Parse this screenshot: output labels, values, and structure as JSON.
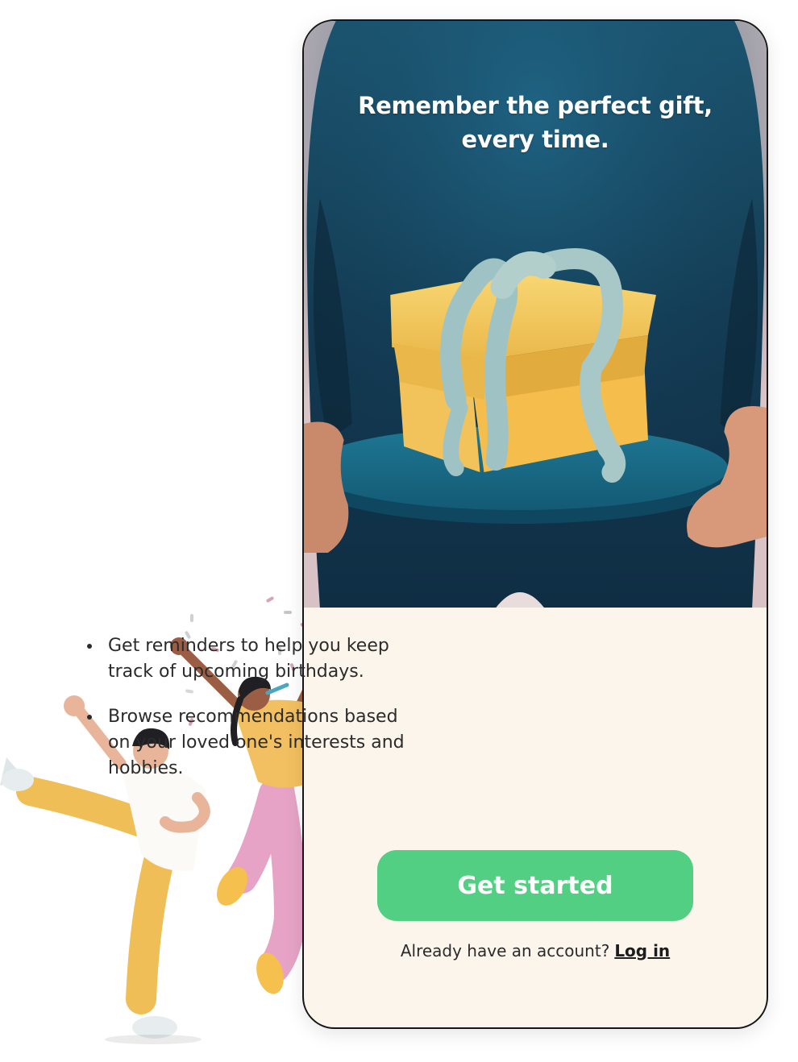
{
  "hero": {
    "title_line1": "Remember the perfect gift,",
    "title_line2": "every time.",
    "illustration": "person-holding-wrapped-gift-on-tray"
  },
  "features": {
    "items": [
      {
        "text": "Get reminders to help you keep track of upcoming birthdays."
      },
      {
        "text": "Browse recommendations based on your loved one's interests and hobbies."
      }
    ]
  },
  "cta": {
    "label": "Get started",
    "color": "#52cf82"
  },
  "login": {
    "prompt": "Already have an account?",
    "link_label": "Log in"
  },
  "decoration": {
    "illustration": "two-people-jumping-celebrating-with-confetti"
  },
  "colors": {
    "accent": "#52cf82",
    "background": "#fcf5ec",
    "hero_dark": "#163a52",
    "gift_yellow": "#f3c457"
  }
}
